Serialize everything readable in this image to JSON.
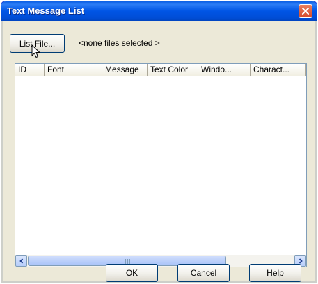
{
  "window": {
    "title": "Text Message List",
    "close_icon": "close-icon"
  },
  "toolbar": {
    "list_file_label": "List File...",
    "status_text": "<none files selected >"
  },
  "list": {
    "columns": [
      "ID",
      "Font",
      "Message",
      "Text Color",
      "Windo...",
      "Charact..."
    ],
    "rows": []
  },
  "buttons": {
    "ok": "OK",
    "cancel": "Cancel",
    "help": "Help"
  },
  "icons": {
    "scroll_left": "chevron-left-icon",
    "scroll_right": "chevron-right-icon",
    "cursor": "mouse-cursor-icon"
  }
}
